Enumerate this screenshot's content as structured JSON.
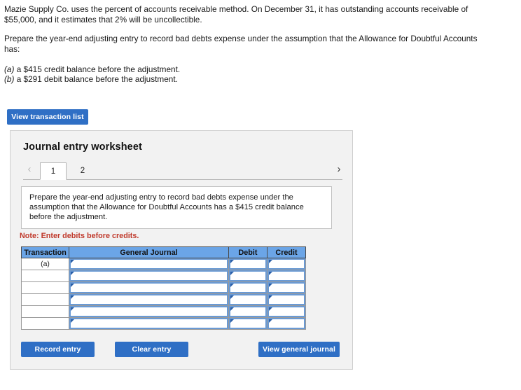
{
  "problem": {
    "paragraph1": "Mazie Supply Co. uses the percent of accounts receivable method. On December 31, it has outstanding accounts receivable of $55,000, and it estimates that 2% will be uncollectible.",
    "paragraph2": "Prepare the year-end adjusting entry to record bad debts expense under the assumption that the Allowance for Doubtful Accounts has:",
    "option_a_label": "(a)",
    "option_a_text": " a $415 credit balance before the adjustment.",
    "option_b_label": "(b)",
    "option_b_text": " a $291 debit balance before the adjustment."
  },
  "toolbar": {
    "view_transaction_list_label": "View transaction list"
  },
  "worksheet": {
    "title": "Journal entry worksheet",
    "prev_icon": "chevron-left-icon",
    "next_icon": "chevron-right-icon",
    "prev_glyph": "‹",
    "next_glyph": "›",
    "tabs": [
      {
        "label": "1",
        "active": true
      },
      {
        "label": "2",
        "active": false
      }
    ],
    "instruction": "Prepare the year-end adjusting entry to record bad debts expense under the assumption that the Allowance for Doubtful Accounts has a $415 credit balance before the adjustment.",
    "note": "Note: Enter debits before credits.",
    "table": {
      "headers": [
        "Transaction",
        "General Journal",
        "Debit",
        "Credit"
      ],
      "rows": [
        {
          "transaction": "(a)",
          "general_journal": "",
          "debit": "",
          "credit": ""
        },
        {
          "transaction": "",
          "general_journal": "",
          "debit": "",
          "credit": ""
        },
        {
          "transaction": "",
          "general_journal": "",
          "debit": "",
          "credit": ""
        },
        {
          "transaction": "",
          "general_journal": "",
          "debit": "",
          "credit": ""
        },
        {
          "transaction": "",
          "general_journal": "",
          "debit": "",
          "credit": ""
        },
        {
          "transaction": "",
          "general_journal": "",
          "debit": "",
          "credit": ""
        }
      ]
    },
    "buttons": {
      "record_entry": "Record entry",
      "clear_entry": "Clear entry",
      "view_general_journal": "View general journal"
    }
  },
  "colors": {
    "button_blue": "#2f6fc5",
    "header_blue": "#6ba5e7",
    "note_red": "#c0392b",
    "panel_gray": "#f2f2f2",
    "cell_border_blue": "#6a9ad4"
  }
}
